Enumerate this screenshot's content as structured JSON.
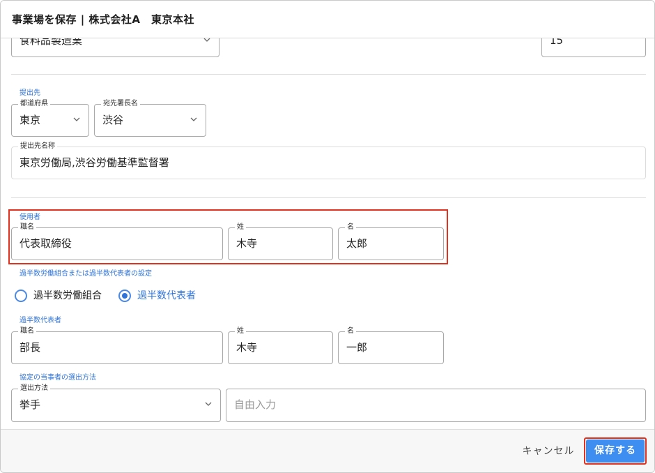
{
  "header": {
    "title": "事業場を保存 | 株式会社A　東京本社"
  },
  "top_row": {
    "industry_value": "食料品製造業",
    "number_value": "15"
  },
  "submission": {
    "group_label": "提出先",
    "prefecture_label": "都道府県",
    "prefecture_value": "東京",
    "office_head_label": "宛先署長名",
    "office_head_value": "渋谷",
    "destination_label": "提出先名称",
    "destination_value": "東京労働局,渋谷労働基準監督署"
  },
  "employer": {
    "group_label": "使用者",
    "title_label": "職名",
    "title_value": "代表取締役",
    "surname_label": "姓",
    "surname_value": "木寺",
    "given_label": "名",
    "given_value": "太郎"
  },
  "majority_setting": {
    "group_label": "過半数労働組合または過半数代表者の設定",
    "options": [
      {
        "label": "過半数労働組合",
        "checked": false
      },
      {
        "label": "過半数代表者",
        "checked": true
      }
    ]
  },
  "majority_rep": {
    "group_label": "過半数代表者",
    "title_label": "職名",
    "title_value": "部長",
    "surname_label": "姓",
    "surname_value": "木寺",
    "given_label": "名",
    "given_value": "一郎"
  },
  "selection_method": {
    "group_label": "協定の当事者の選出方法",
    "method_label": "選出方法",
    "method_value": "挙手",
    "free_input_placeholder": "自由入力"
  },
  "footer": {
    "cancel_label": "キャンセル",
    "save_label": "保存する"
  },
  "colors": {
    "accent": "#3d8ef0",
    "label_blue": "#2f74d8",
    "highlight_red": "#e0321e"
  }
}
